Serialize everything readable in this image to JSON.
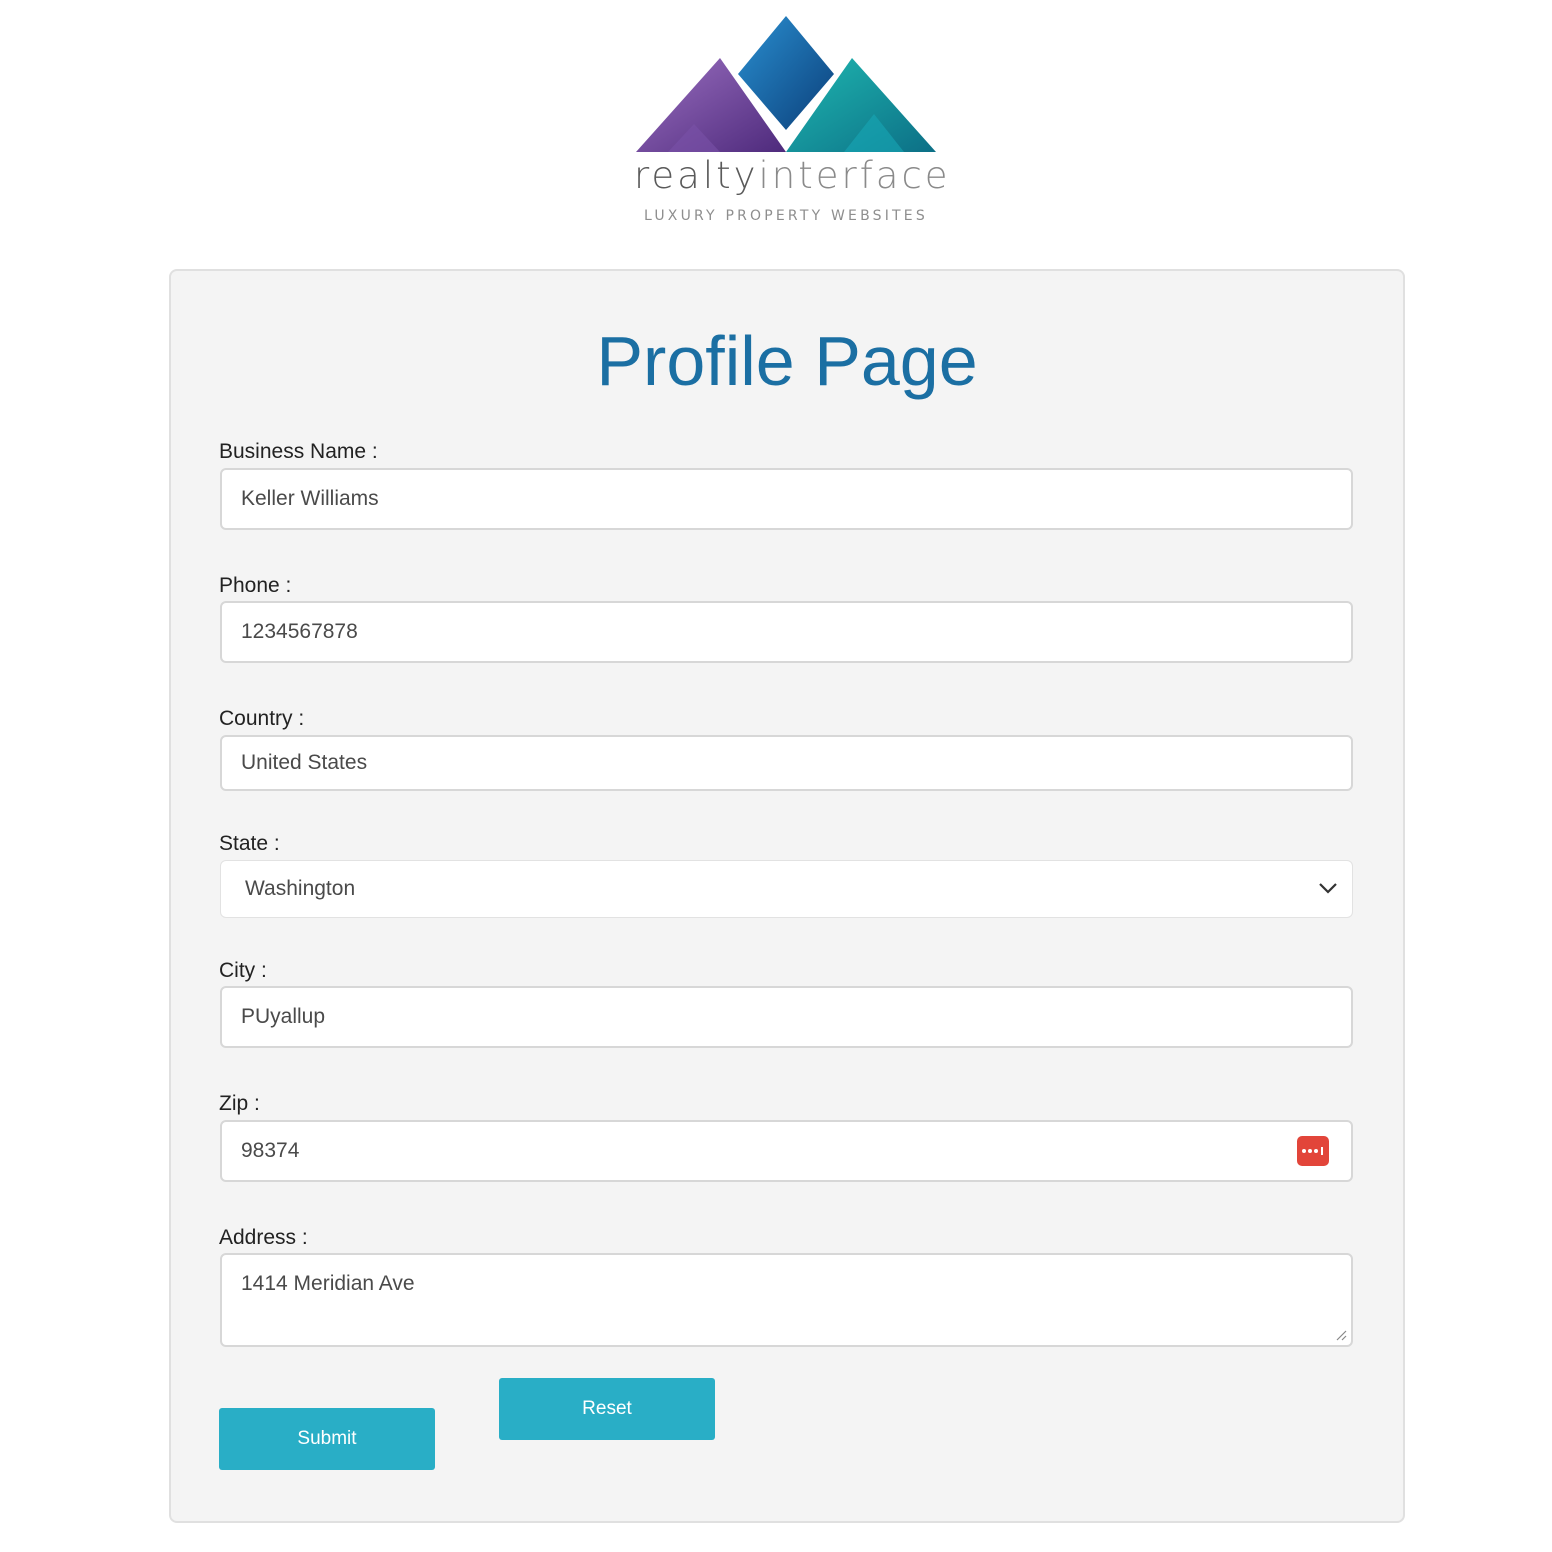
{
  "logo": {
    "brand_main": "realty",
    "brand_suffix": "interface",
    "tagline": "LUXURY PROPERTY WEBSITES"
  },
  "page": {
    "title": "Profile Page"
  },
  "form": {
    "business_name": {
      "label": "Business Name :",
      "value": "Keller Williams"
    },
    "phone": {
      "label": "Phone :",
      "value": "1234567878"
    },
    "country": {
      "label": "Country :",
      "value": "United States"
    },
    "state": {
      "label": "State :",
      "value": "Washington"
    },
    "city": {
      "label": "City :",
      "value": "PUyallup"
    },
    "zip": {
      "label": "Zip :",
      "value": "98374"
    },
    "address": {
      "label": "Address :",
      "value": "1414 Meridian Ave"
    }
  },
  "buttons": {
    "submit": "Submit",
    "reset": "Reset"
  },
  "colors": {
    "title": "#1b6fa3",
    "button": "#29aec6",
    "password_manager_icon": "#e2453a",
    "card_bg": "#f4f4f4"
  },
  "icons": {
    "logo": "triangles-logo-icon",
    "state_dropdown": "chevron-down-icon",
    "zip_field": "password-manager-icon",
    "address_resize": "resize-grip-icon"
  }
}
